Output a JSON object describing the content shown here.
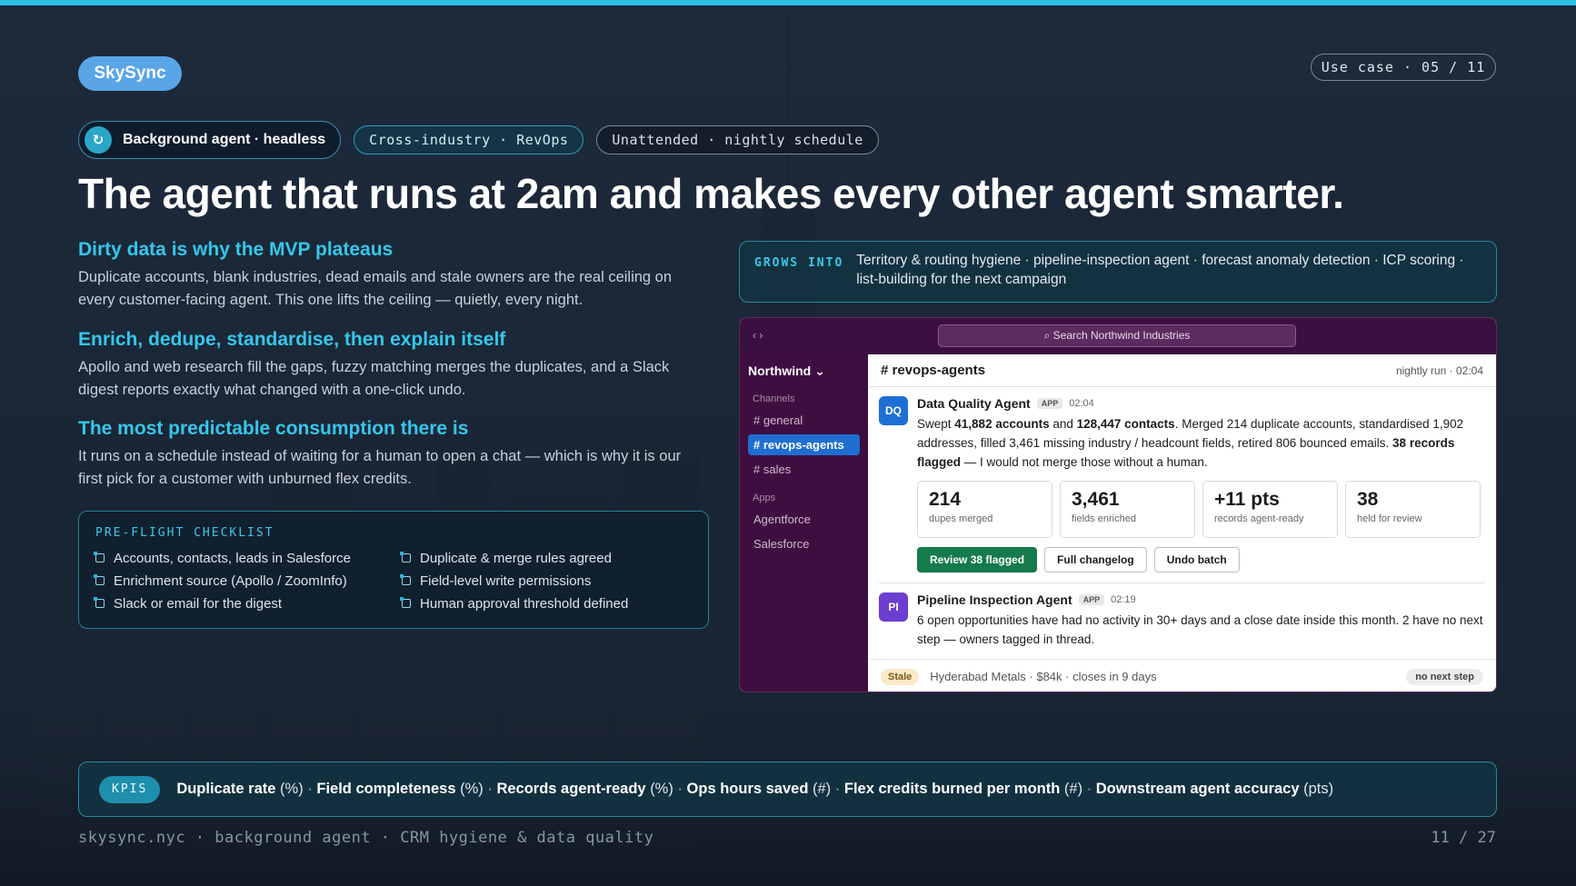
{
  "brand": "SkySync",
  "use_case": "Use case · 05 / 11",
  "tags": {
    "agent": "Background agent · headless",
    "industry": "Cross-industry · RevOps",
    "schedule": "Unattended · nightly schedule"
  },
  "headline": "The agent that runs at 2am and makes every other agent smarter.",
  "sections": [
    {
      "title": "Dirty data is why the MVP plateaus",
      "body": "Duplicate accounts, blank industries, dead emails and stale owners are the real ceiling on every customer-facing agent. This one lifts the ceiling — quietly, every night."
    },
    {
      "title": "Enrich, dedupe, standardise, then explain itself",
      "body": "Apollo and web research fill the gaps, fuzzy matching merges the duplicates, and a Slack digest reports exactly what changed with a one-click undo."
    },
    {
      "title": "The most predictable consumption there is",
      "body": "It runs on a schedule instead of waiting for a human to open a chat — which is why it is our first pick for a customer with unburned flex credits."
    }
  ],
  "checklist": {
    "title": "PRE-FLIGHT CHECKLIST",
    "items": [
      "Accounts, contacts, leads in Salesforce",
      "Duplicate & merge rules agreed",
      "Enrichment source (Apollo / ZoomInfo)",
      "Field-level write permissions",
      "Slack or email for the digest",
      "Human approval threshold defined"
    ]
  },
  "grows_into": {
    "label": "GROWS INTO",
    "text": "Territory & routing hygiene · pipeline-inspection agent · forecast anomaly detection · ICP scoring · list-building for the next campaign"
  },
  "slack": {
    "arrows": "‹ ›",
    "search": "⌕ Search Northwind Industries",
    "workspace": "Northwind ⌄",
    "channels_label": "Channels",
    "channels": [
      "# general",
      "# revops-agents",
      "# sales"
    ],
    "apps_label": "Apps",
    "apps": [
      "Agentforce",
      "Salesforce"
    ],
    "channel_title": "# revops-agents",
    "run_info": "nightly run · 02:04",
    "msg1": {
      "avatar": "DQ",
      "name": "Data Quality Agent",
      "app": "APP",
      "time": "02:04",
      "t1": "Swept ",
      "b1": "41,882 accounts",
      "t2": " and ",
      "b2": "128,447 contacts",
      "t3": ". Merged 214 duplicate accounts, standardised 1,902 addresses, filled 3,461 missing industry / headcount fields, retired 806 bounced emails. ",
      "b3": "38 records flagged",
      "t4": " — I would not merge those without a human."
    },
    "stats": [
      {
        "value": "214",
        "label": "dupes merged"
      },
      {
        "value": "3,461",
        "label": "fields enriched"
      },
      {
        "value": "+11 pts",
        "label": "records agent-ready"
      },
      {
        "value": "38",
        "label": "held for review"
      }
    ],
    "buttons": {
      "review": "Review 38 flagged",
      "changelog": "Full changelog",
      "undo": "Undo batch"
    },
    "msg2": {
      "avatar": "PI",
      "name": "Pipeline Inspection Agent",
      "app": "APP",
      "time": "02:19",
      "text": "6 open opportunities have had no activity in 30+ days and a close date inside this month. 2 have no next step — owners tagged in thread."
    },
    "footer": {
      "badge": "Stale",
      "text": "Hyderabad Metals · $84k · closes in 9 days",
      "tag": "no next step"
    }
  },
  "kpis": {
    "badge": "KPIS",
    "items": [
      {
        "name": "Duplicate rate",
        "unit": "(%)"
      },
      {
        "name": "Field completeness",
        "unit": "(%)"
      },
      {
        "name": "Records agent-ready",
        "unit": "(%)"
      },
      {
        "name": "Ops hours saved",
        "unit": "(#)"
      },
      {
        "name": "Flex credits burned per month",
        "unit": "(#)"
      },
      {
        "name": "Downstream agent accuracy",
        "unit": "(pts)"
      }
    ],
    "separator": " · "
  },
  "footer": {
    "left": "skysync.nyc · background agent · CRM hygiene & data quality",
    "page": "11 / 27"
  },
  "colors": {
    "accent": "#35c7eb",
    "brand": "#59a5e6",
    "slack_sidebar": "#3f0e40",
    "primary_button": "#157a4c"
  }
}
